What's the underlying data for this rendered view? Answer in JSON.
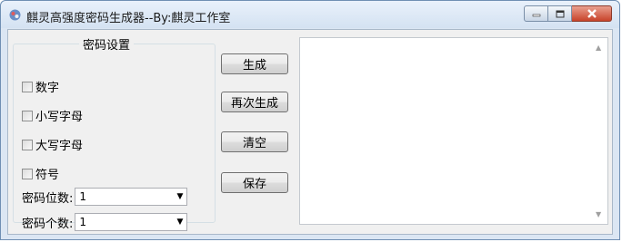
{
  "window": {
    "title": "麒灵高强度密码生成器--By:麒灵工作室"
  },
  "settings": {
    "group_title": "密码设置",
    "options": [
      {
        "label": "数字",
        "checked": false
      },
      {
        "label": "小写字母",
        "checked": false
      },
      {
        "label": "大写字母",
        "checked": false
      },
      {
        "label": "符号",
        "checked": false
      }
    ],
    "length_label": "密码位数:",
    "length_value": "1",
    "count_label": "密码个数:",
    "count_value": "1"
  },
  "buttons": {
    "generate": "生成",
    "regenerate": "再次生成",
    "clear": "清空",
    "save": "保存"
  },
  "output": {
    "text": ""
  },
  "icons": {
    "app": "app-icon",
    "minimize": "minimize-icon",
    "maximize": "maximize-icon",
    "close": "close-icon",
    "dropdown": "chevron-down-icon"
  }
}
